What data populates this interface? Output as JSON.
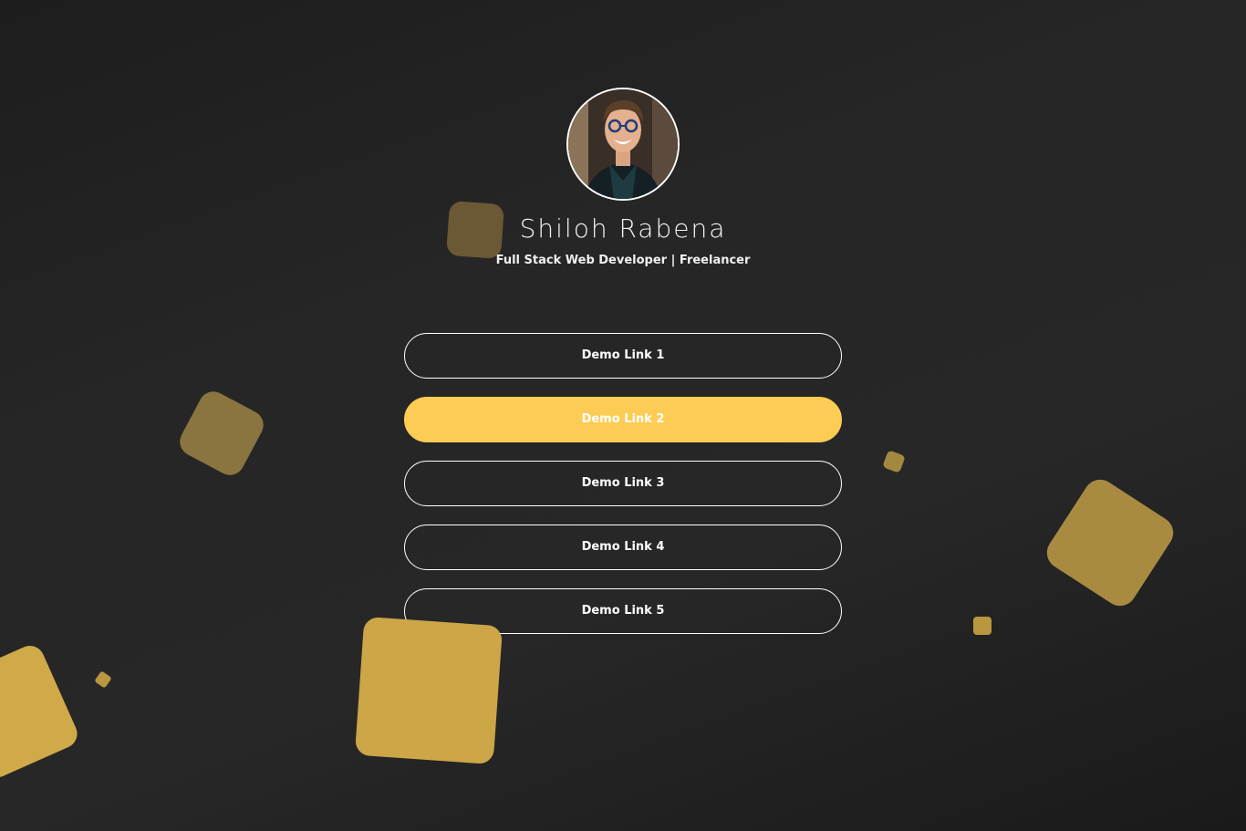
{
  "profile": {
    "name": "Shiloh Rabena",
    "tagline": "Full Stack Web Developer | Freelancer"
  },
  "links": [
    {
      "label": "Demo Link 1",
      "active": false
    },
    {
      "label": "Demo Link 2",
      "active": true
    },
    {
      "label": "Demo Link 3",
      "active": false
    },
    {
      "label": "Demo Link 4",
      "active": false
    },
    {
      "label": "Demo Link 5",
      "active": false
    }
  ],
  "colors": {
    "accent": "#fdcc54",
    "background": "#252525",
    "text": "#ffffff"
  }
}
